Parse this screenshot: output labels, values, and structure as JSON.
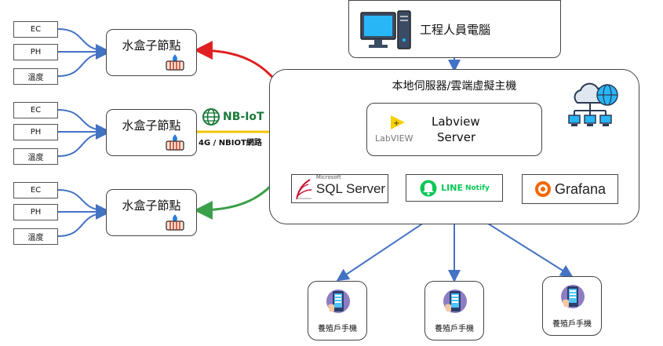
{
  "sensors": [
    {
      "label": "EC"
    },
    {
      "label": "PH"
    },
    {
      "label": "溫度"
    },
    {
      "label": "EC"
    },
    {
      "label": "PH"
    },
    {
      "label": "溫度"
    },
    {
      "label": "EC"
    },
    {
      "label": "PH"
    },
    {
      "label": "溫度"
    }
  ],
  "nodes": [
    {
      "label": "水盒子節點"
    },
    {
      "label": "水盒子節點"
    },
    {
      "label": "水盒子節點"
    }
  ],
  "network": {
    "logo_text": "NB-IoT",
    "label": "4G / NBIOT網路"
  },
  "engineer_pc": {
    "label": "工程人員電腦"
  },
  "server_group": {
    "title": "本地伺服器/雲端虛擬主機"
  },
  "labview": {
    "logo_text": "LabVIEW",
    "title_line1": "Labview",
    "title_line2": "Server"
  },
  "services": {
    "sql": {
      "small": "Microsoft",
      "name": "SQL Server"
    },
    "line": {
      "name": "LINE",
      "suffix": "Notify"
    },
    "grafana": {
      "name": "Grafana"
    }
  },
  "phones": [
    {
      "label": "養殖戶手機"
    },
    {
      "label": "養殖戶手機"
    },
    {
      "label": "養殖戶手機"
    }
  ],
  "colors": {
    "connector_blue": "#4472c4",
    "link_red": "#e02020",
    "link_yellow": "#f2c500",
    "link_green": "#3aa04a",
    "nbiot_green": "#1a7a3a",
    "grafana_orange": "#f46800",
    "line_green": "#06c755",
    "sql_red": "#c8102e",
    "labview_yellow": "#f5d000"
  }
}
